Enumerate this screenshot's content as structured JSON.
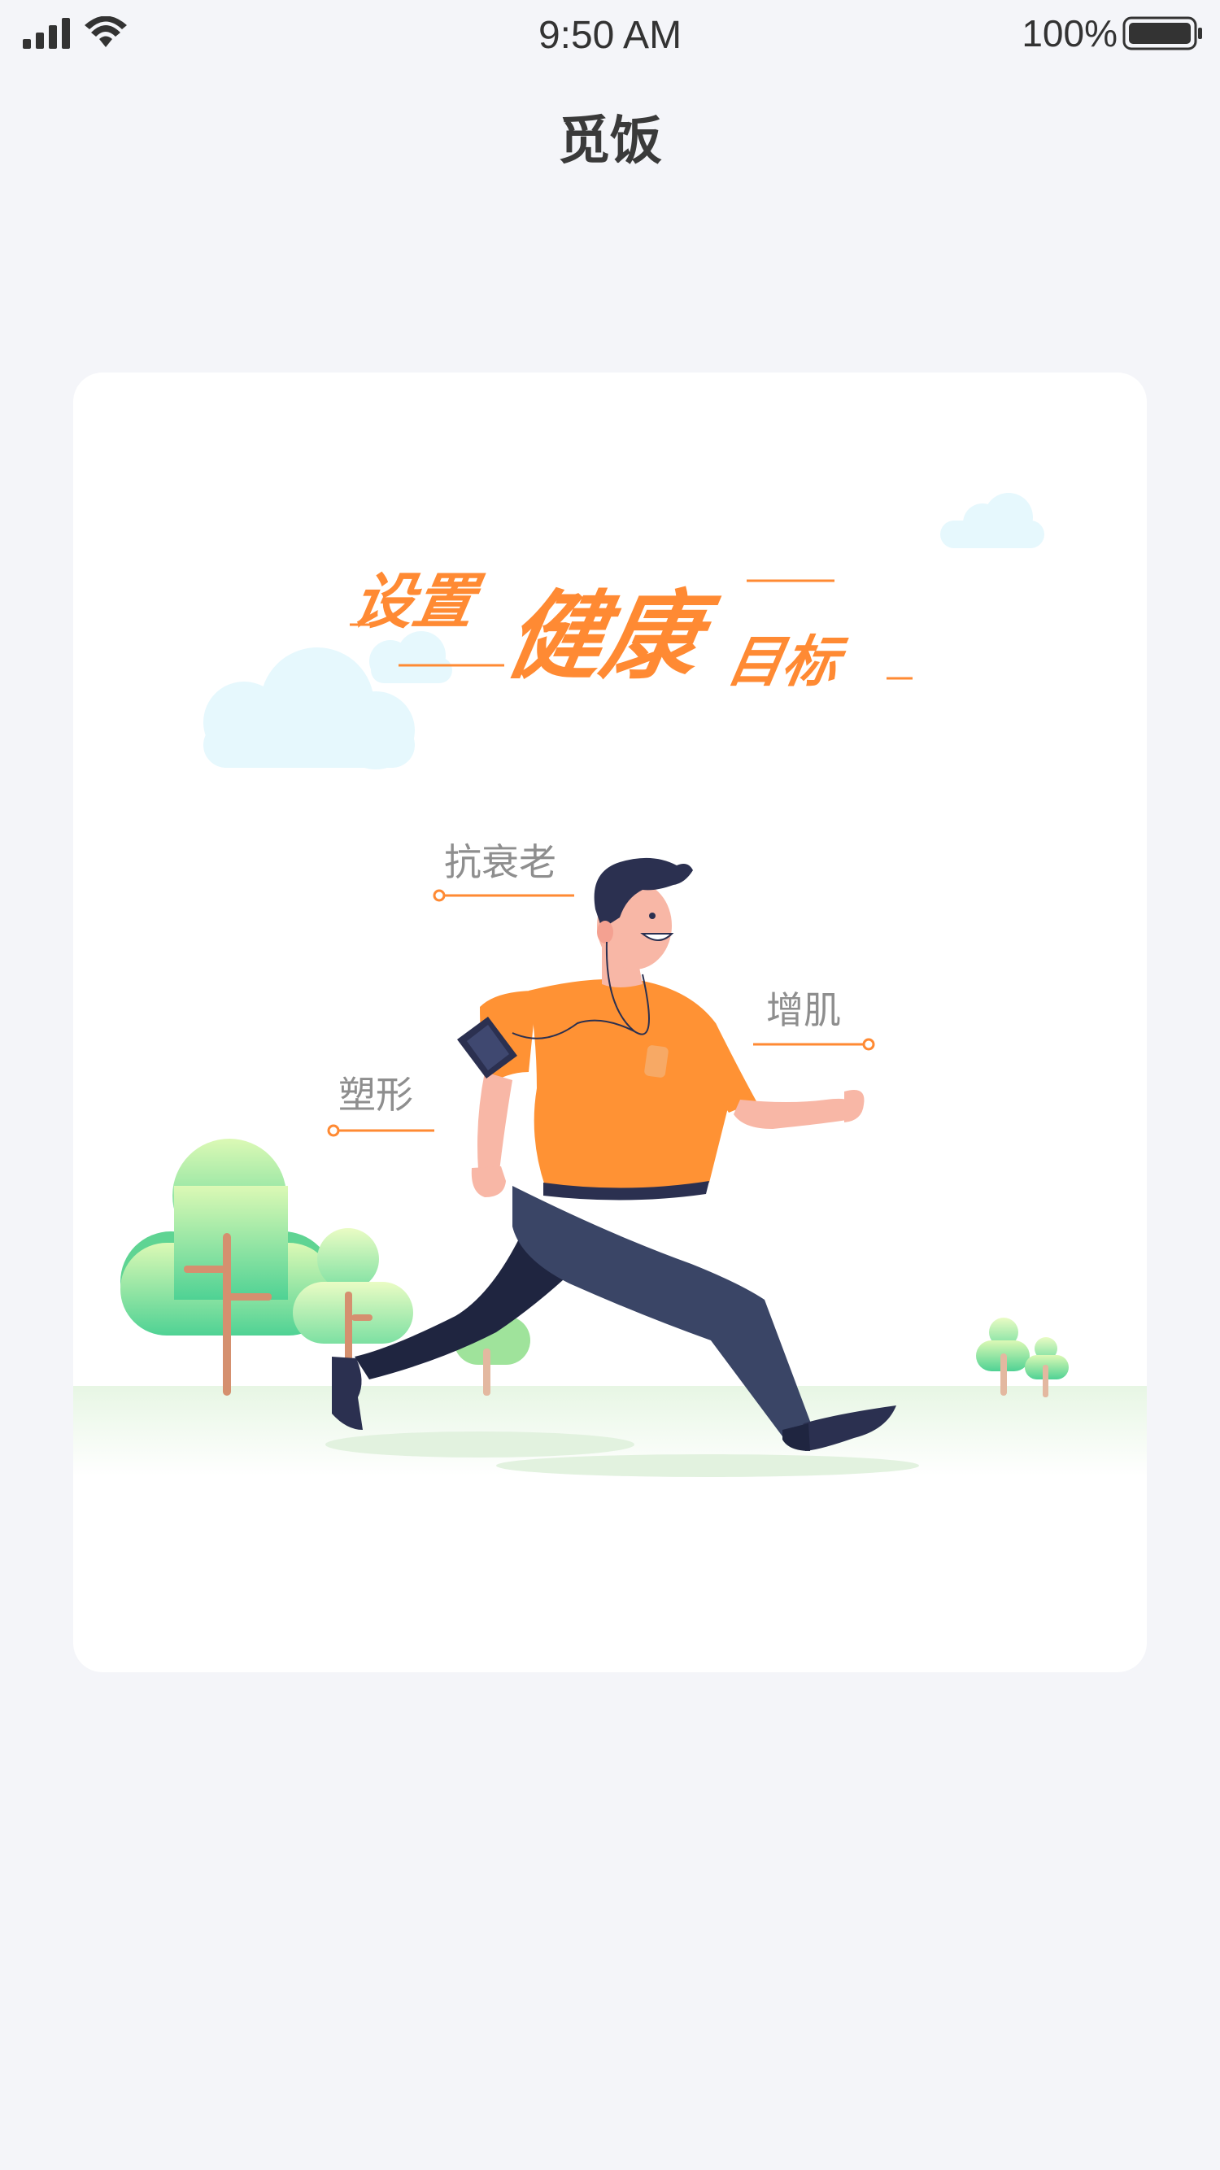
{
  "status_bar": {
    "time": "9:50 AM",
    "battery_percent": "100%",
    "battery_level": 1.0,
    "icons": [
      "signal-icon",
      "wifi-icon",
      "battery-icon"
    ]
  },
  "nav": {
    "title": "觅饭"
  },
  "card": {
    "headline": {
      "part1": "设置",
      "part2": "健康",
      "part3": "目标"
    },
    "goals": {
      "anti_aging": "抗衰老",
      "muscle_gain": "增肌",
      "body_shaping": "塑形"
    }
  },
  "colors": {
    "background": "#f4f5f9",
    "card": "#ffffff",
    "accent_orange": "#ff8a33",
    "label_gray": "#8e8e8e",
    "pants_navy": "#3a4566",
    "tree_green": "#5fd493",
    "cloud_blue": "#e6f8fd"
  }
}
